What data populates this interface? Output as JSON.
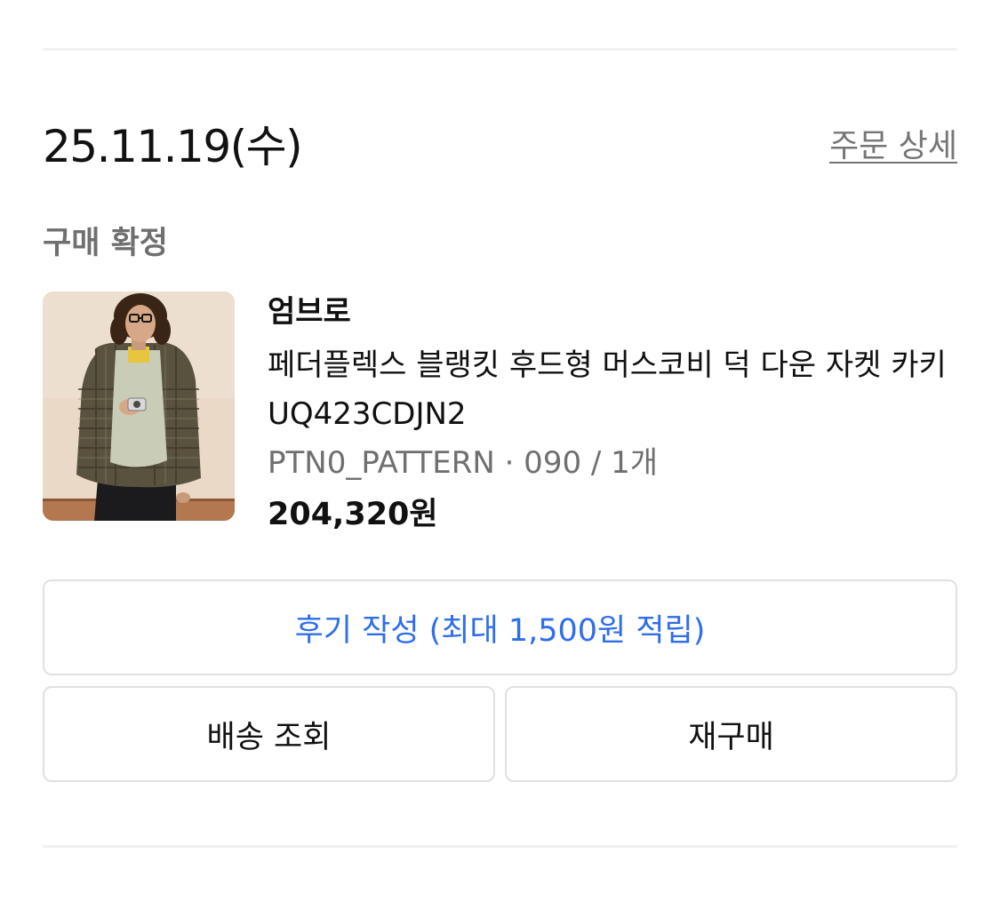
{
  "order": {
    "date": "25.11.19(수)",
    "detail_link": "주문 상세",
    "status": "구매 확정"
  },
  "product": {
    "thumbnail_icon": "product-photo-icon",
    "brand": "엄브로",
    "name": "페더플렉스 블랭킷 후드형 머스코비 덕 다운 자켓 카키 UQ423CDJN2",
    "option": "PTN0_PATTERN · 090 / 1개",
    "price": "204,320원"
  },
  "actions": {
    "review_label": "후기 작성 (최대 1,500원 적립)",
    "shipping_label": "배송 조회",
    "repurchase_label": "재구매"
  },
  "colors": {
    "accent": "#2f6eea",
    "muted_text": "#6f6f6f",
    "border": "#e1e1e1"
  }
}
